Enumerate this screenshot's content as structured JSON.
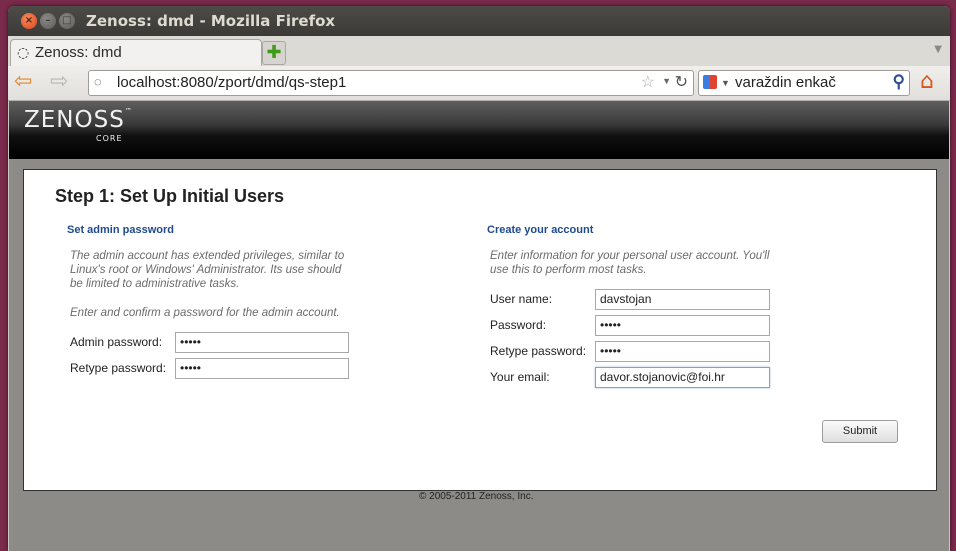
{
  "window": {
    "title": "Zenoss: dmd - Mozilla Firefox",
    "close_glyph": "×",
    "min_glyph": "–",
    "max_glyph": "□"
  },
  "browser": {
    "tab_label": "Zenoss: dmd",
    "new_tab_glyph": "✚",
    "url": "localhost:8080/zport/dmd/qs-step1",
    "search_value": "varaždin enkač",
    "back_glyph": "⇦",
    "forward_glyph": "⇨",
    "star_glyph": "☆",
    "reload_glyph": "↻",
    "search_glyph": "⚲",
    "home_glyph": "⌂",
    "dropdown_glyph": "▼",
    "site_icon_glyph": "◌"
  },
  "header": {
    "logo_text": "ZENOSS",
    "logo_tm": "™",
    "logo_sub": "CORE"
  },
  "page": {
    "title": "Step 1: Set Up Initial Users",
    "admin": {
      "heading": "Set admin password",
      "description_lines": [
        "The admin account has extended privileges, similar to",
        "Linux's root or Windows' Administrator. Its use should",
        "be limited to administrative tasks."
      ],
      "instruction": "Enter and confirm a password for the admin account.",
      "password_label": "Admin password:",
      "password_value": "•••••",
      "retype_label": "Retype password:",
      "retype_value": "•••••"
    },
    "account": {
      "heading": "Create your account",
      "description_lines": [
        "Enter information for your personal user account. You'll",
        "use this to perform most tasks."
      ],
      "username_label": "User name:",
      "username_value": "davstojan",
      "password_label": "Password:",
      "password_value": "•••••",
      "retype_label": "Retype password:",
      "retype_value": "•••••",
      "email_label": "Your email:",
      "email_value": "davor.stojanovic@foi.hr"
    },
    "submit_label": "Submit",
    "footer": "© 2005-2011 Zenoss, Inc."
  },
  "colors": {
    "section_heading": "#1f4a8c",
    "nav_back": "#e8862a",
    "new_tab_plus": "#3e9a18"
  }
}
